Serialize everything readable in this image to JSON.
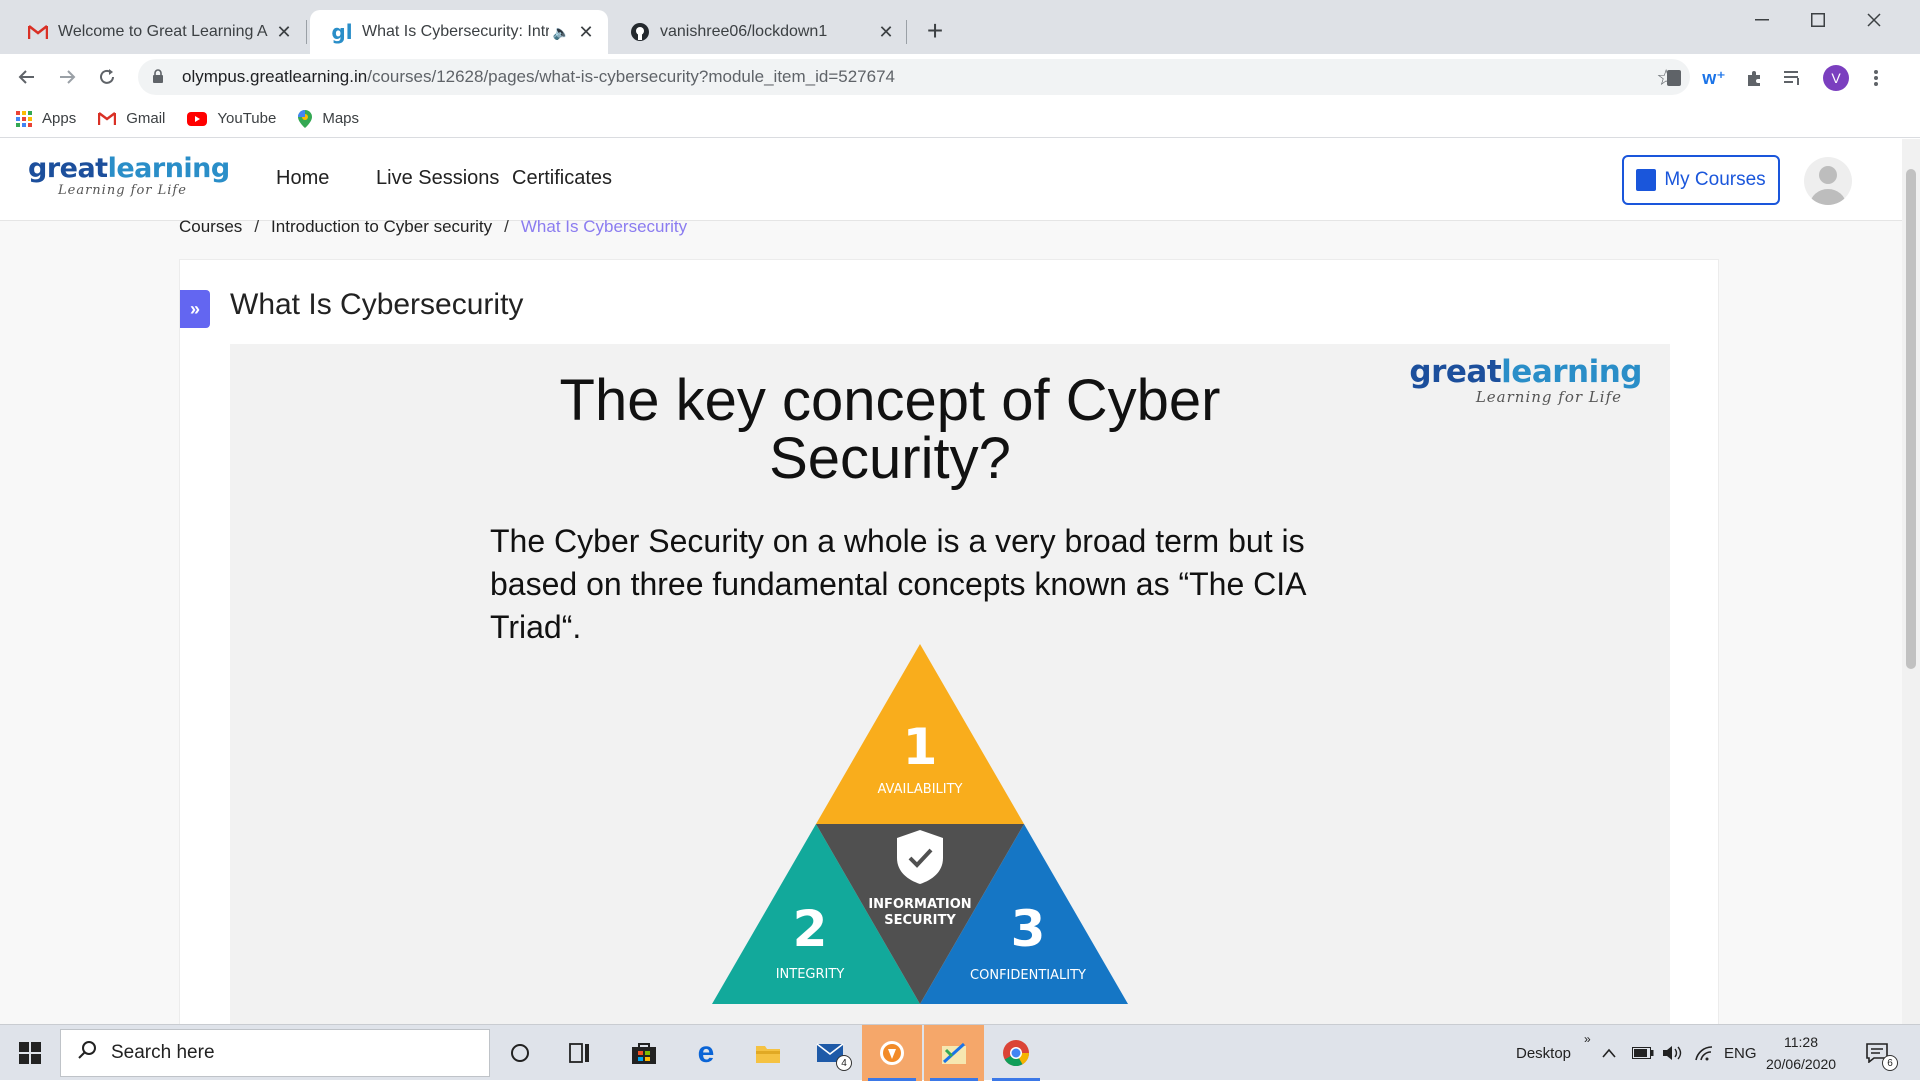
{
  "browser": {
    "tabs": [
      {
        "title": "Welcome to Great Learning Acad",
        "close": "✕"
      },
      {
        "title": "What Is Cybersecurity: Introd",
        "close": "✕"
      },
      {
        "title": "vanishree06/lockdown1",
        "close": "✕"
      }
    ],
    "new_tab": "+",
    "url_host": "olympus.greatlearning.in",
    "url_path": "/courses/12628/pages/what-is-cybersecurity?module_item_id=527674",
    "profile_initial": "V",
    "bookmarks": [
      {
        "label": "Apps",
        "icon": "apps-grid-icon"
      },
      {
        "label": "Gmail",
        "icon": "gmail-icon"
      },
      {
        "label": "YouTube",
        "icon": "youtube-icon"
      },
      {
        "label": "Maps",
        "icon": "maps-icon"
      }
    ]
  },
  "site": {
    "logo_main_a": "great",
    "logo_main_b": "learning",
    "logo_tag": "Learning for Life",
    "nav": [
      "Home",
      "Live Sessions",
      "Certificates"
    ],
    "my_courses": "My Courses"
  },
  "breadcrumb": [
    "Courses",
    "Introduction to Cyber security",
    "What Is Cybersecurity"
  ],
  "breadcrumb_sep": "/",
  "page": {
    "title": "What Is Cybersecurity",
    "toggle": "»"
  },
  "slide": {
    "logo_main_a": "great",
    "logo_main_b": "learning",
    "logo_tag": "Learning for Life",
    "title": "The key concept of Cyber Security?",
    "body": "The Cyber Security on a whole is a very broad term but is based on three fundamental concepts known as “The CIA Triad“.",
    "triad": {
      "top_num": "1",
      "top_label": "AVAILABILITY",
      "left_num": "2",
      "left_label": "INTEGRITY",
      "right_num": "3",
      "right_label": "CONFIDENTIALITY",
      "center_line1": "INFORMATION",
      "center_line2": "SECURITY",
      "colors": {
        "top": "#f9ad1c",
        "left": "#12a99b",
        "right": "#1576c5",
        "center": "#505050"
      }
    }
  },
  "taskbar": {
    "search_placeholder": "Search here",
    "mail_badge": "4",
    "desktop_label": "Desktop",
    "lang": "ENG",
    "time": "11:28",
    "date": "20/06/2020",
    "notif_badge": "6"
  }
}
